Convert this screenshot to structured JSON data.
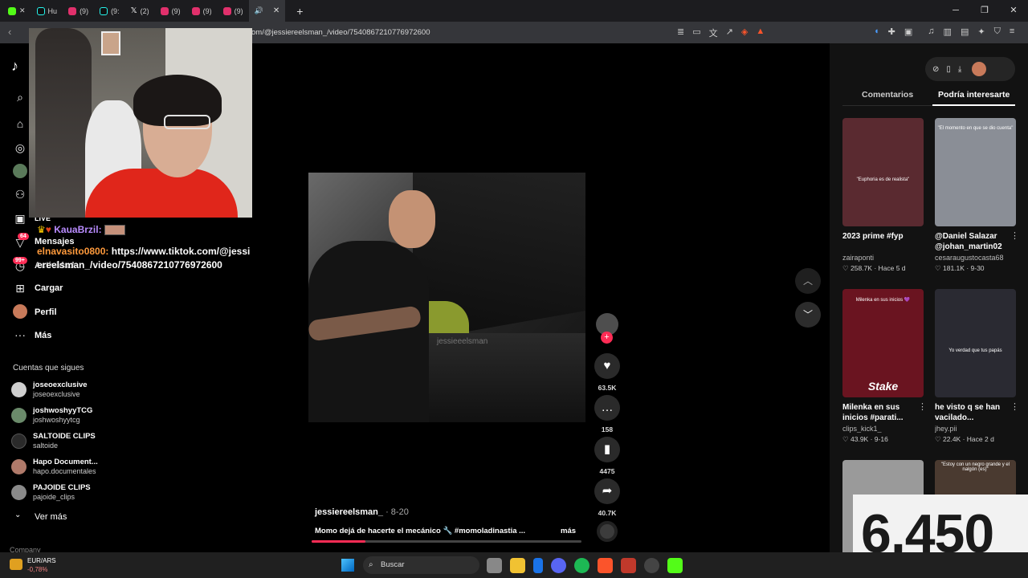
{
  "browser": {
    "tabs": [
      {
        "label": "Hu",
        "color": "#25f4ee"
      },
      {
        "label": "(9)",
        "color": "#e1306c"
      },
      {
        "label": "(9:",
        "color": "#25f4ee"
      },
      {
        "label": "(2)",
        "color": "#ffffff"
      },
      {
        "label": "(9)",
        "color": "#e1306c"
      },
      {
        "label": "(9)",
        "color": "#e1306c"
      },
      {
        "label": "(9)",
        "color": "#e1306c"
      }
    ],
    "url": "om/@jessiereelsman_/video/7540867210776972600"
  },
  "sidebar": {
    "nav": [
      {
        "label": "LIVE",
        "icon": "live-icon"
      },
      {
        "label": "Mensajes",
        "icon": "messages-icon",
        "badge": "64"
      },
      {
        "label": "Actividad",
        "icon": "activity-icon",
        "badge": "99+"
      },
      {
        "label": "Cargar",
        "icon": "upload-icon"
      },
      {
        "label": "Perfil",
        "icon": "profile-icon"
      },
      {
        "label": "Más",
        "icon": "more-icon"
      }
    ],
    "following_title": "Cuentas que sigues",
    "accounts": [
      {
        "name": "joseoexclusive",
        "handle": "joseoexclusive"
      },
      {
        "name": "joshwoshyyTCG",
        "handle": "joshwoshyytcg"
      },
      {
        "name": "SALTOIDE CLIPS",
        "handle": "saltoide"
      },
      {
        "name": "Hapo Document...",
        "handle": "hapo.documentales"
      },
      {
        "name": "PAJOIDE CLIPS",
        "handle": "pajoide_clips"
      }
    ],
    "see_more": "Ver más",
    "company": "Company"
  },
  "chat": {
    "msg1_user": "KauaBrzil:",
    "msg2_user": "elnavasito0800:",
    "msg2_text": "https://www.tiktok.com/@jessiereelsman_/video/7540867210776972600"
  },
  "video": {
    "watermark": "jessieeelsman",
    "author": "jessiereelsman_",
    "date": "· 8-20",
    "caption": "Momo dejá de hacerte el mecánico 🔧 #momoladinastia ...",
    "more": "más",
    "progress": 0.2,
    "likes": "63.5K",
    "comments": "158",
    "saves": "4475",
    "shares": "40.7K"
  },
  "right_panel": {
    "tab_comments": "Comentarios",
    "tab_suggested": "Podría interesarte",
    "cards": [
      {
        "title": "2023 prime #fyp",
        "author": "zairaponti",
        "likes": "258.7K",
        "time": "Hace 5 d",
        "thumb_text": "\"Euphoria es de realista\"",
        "bg": "#5a2a30"
      },
      {
        "title": "@Daniel Salazar @johan_martin02",
        "author": "cesaraugustocasta68",
        "likes": "181.1K",
        "time": "9-30",
        "thumb_text": "\"El momento en que se dio cuenta\"",
        "bg": "#8a8e96"
      },
      {
        "title": "Milenka en sus inicios #parati...",
        "author": "clips_kick1_",
        "likes": "43.9K",
        "time": "9-16",
        "thumb_text": "Milenka en sus inicios 💜",
        "thumb_brand": "Stake",
        "bg": "#6a1420"
      },
      {
        "title": "he visto q se han vacilado...",
        "author": "jhey.pii",
        "likes": "22.4K",
        "time": "Hace 2 d",
        "thumb_text": "Yo verdad que tus papás",
        "bg": "#2a2a32"
      },
      {
        "title": "",
        "author": "",
        "likes": "",
        "time": "",
        "thumb_text": "",
        "bg": "#9a9a9a"
      },
      {
        "title": "",
        "author": "",
        "likes": "",
        "time": "",
        "thumb_text": "\"Estoy con un negro grande y el nalgón (es)\"",
        "bg": "#4a3a30"
      }
    ]
  },
  "overlay_counter": "6,450",
  "taskbar": {
    "ticker_name": "EUR/ARS",
    "ticker_value": "-0,78%",
    "search_label": "Buscar"
  }
}
